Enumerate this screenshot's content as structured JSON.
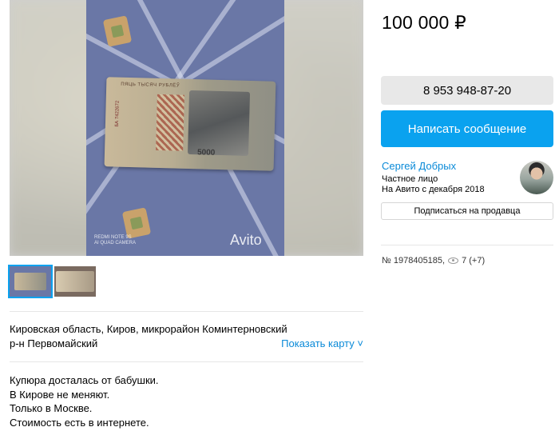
{
  "gallery": {
    "banknote_top_text": "ПЯЦЬ ТЫСЯЧ РУБЛЁЎ",
    "banknote_serial": "БА 7422672",
    "banknote_denomination": "5000",
    "watermark_line1": "REDMI NOTE 9S",
    "watermark_line2": "AI QUAD CAMERA",
    "watermark_logo": "Avito"
  },
  "listing": {
    "price": "100 000 ₽",
    "phone": "8 953 948-87-20",
    "message_label": "Написать сообщение",
    "id_text": "№ 1978405185,",
    "views_text": "7 (+7)"
  },
  "seller": {
    "name": "Сергей Добрых",
    "type": "Частное лицо",
    "since": "На Авито с декабря 2018",
    "subscribe_label": "Подписаться на продавца"
  },
  "address": {
    "line1": "Кировская область, Киров, микрорайон Коминтерновский",
    "line2": "р-н Первомайский",
    "map_link": "Показать карту"
  },
  "description": {
    "lines": [
      "Купюра досталась от бабушки.",
      "В Кирове не меняют.",
      "Только в Москве.",
      "Стоимость есть в интернете."
    ]
  },
  "colors": {
    "accent": "#0aa2ef",
    "link": "#0a8ad8",
    "button_gray": "#e8e8e8"
  }
}
